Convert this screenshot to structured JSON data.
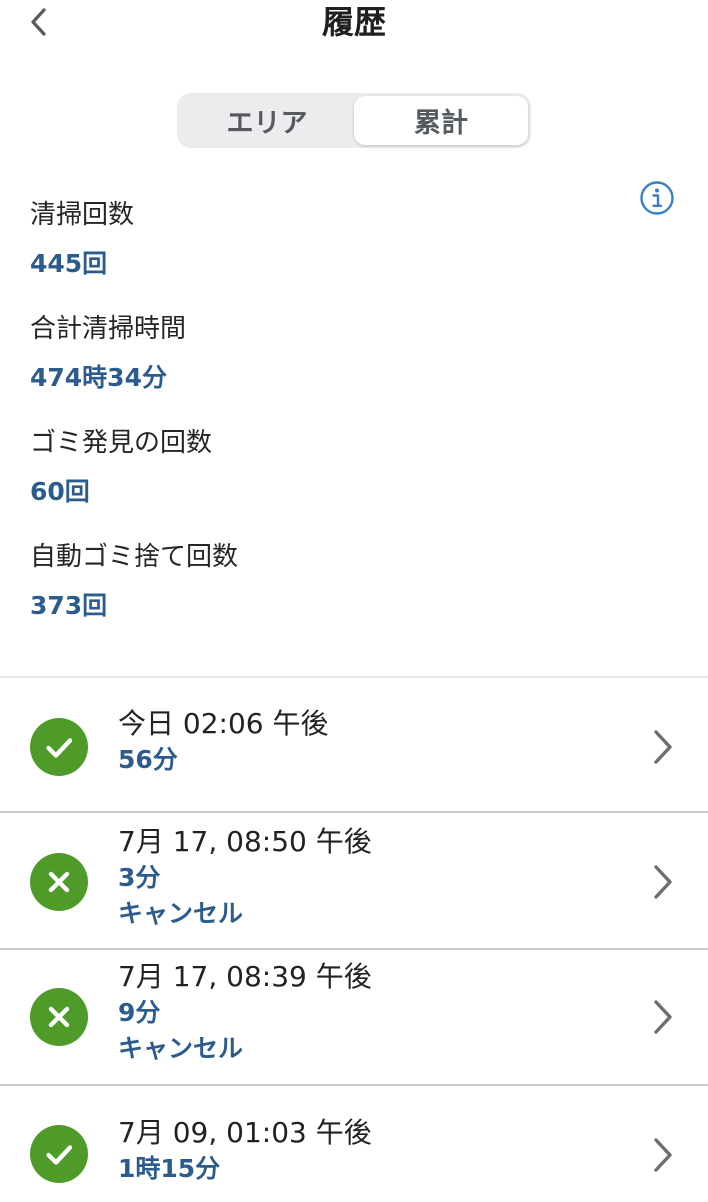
{
  "header": {
    "back_icon": "chevron-left-icon",
    "title": "履歴"
  },
  "tabs": [
    {
      "label": "エリア",
      "active": false
    },
    {
      "label": "累計",
      "active": true
    }
  ],
  "info_icon": "info-icon",
  "stats": [
    {
      "label": "清掃回数",
      "value": "445回"
    },
    {
      "label": "合計清掃時間",
      "value": "474時34分"
    },
    {
      "label": "ゴミ発見の回数",
      "value": "60回"
    },
    {
      "label": "自動ゴミ捨て回数",
      "value": "373回"
    }
  ],
  "history": [
    {
      "status": "completed",
      "icon": "check-circle-icon",
      "date": "今日 02:06 午後",
      "duration": "56分",
      "note": ""
    },
    {
      "status": "cancelled",
      "icon": "x-circle-icon",
      "date": "7月 17, 08:50 午後",
      "duration": "3分",
      "note": "キャンセル"
    },
    {
      "status": "cancelled",
      "icon": "x-circle-icon",
      "date": "7月 17, 08:39 午後",
      "duration": "9分",
      "note": "キャンセル"
    },
    {
      "status": "completed",
      "icon": "check-circle-icon",
      "date": "7月 09, 01:03 午後",
      "duration": "1時15分",
      "note": ""
    }
  ],
  "colors": {
    "accent_text": "#2c5b8e",
    "status_green": "#4f9b2a",
    "segment_bg": "#ececef"
  }
}
